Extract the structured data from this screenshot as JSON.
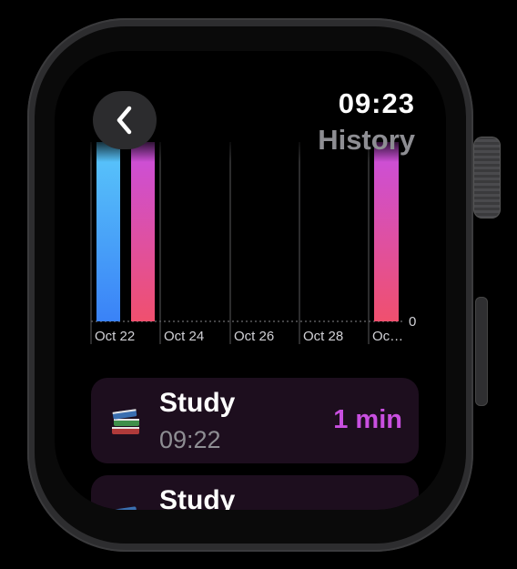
{
  "header": {
    "time": "09:23",
    "title": "History"
  },
  "chart_data": {
    "type": "bar",
    "x_tick_labels": [
      "Oct 22",
      "Oct 24",
      "Oct 26",
      "Oct 28",
      "Oc…"
    ],
    "y_tick_labels": [
      "0"
    ],
    "series": [
      {
        "category": "Oct 22",
        "value": 1,
        "color": "#4ea6ff"
      },
      {
        "category": "Oct 22",
        "value": 1,
        "color": "#d94fd0"
      },
      {
        "category": "Oct 29",
        "value": 1,
        "color": "#d94fd0"
      }
    ],
    "ylim": [
      0,
      1
    ]
  },
  "sessions": [
    {
      "title": "Study",
      "time": "09:22",
      "duration": "1 min",
      "icon": "books-icon"
    },
    {
      "title": "Study",
      "time": "",
      "duration": "",
      "icon": "books-icon"
    }
  ],
  "colors": {
    "accent": "#c94fe0",
    "card_bg": "#1d0e1e",
    "blue_top": "#5ac8fa",
    "blue_bottom": "#3a82f7",
    "pink_top": "#c94fe0",
    "pink_bottom": "#f0506e"
  }
}
